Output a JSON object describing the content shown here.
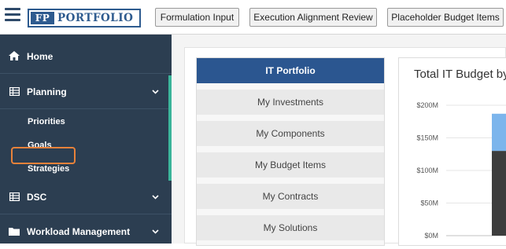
{
  "app": {
    "logo_fp": "FP",
    "logo_text": "PORTFOLIO"
  },
  "top_tabs": [
    {
      "label": "Formulation Input"
    },
    {
      "label": "Execution Alignment Review"
    },
    {
      "label": "Placeholder Budget Items"
    }
  ],
  "sidebar": {
    "home": {
      "label": "Home",
      "icon": "home-icon"
    },
    "planning": {
      "label": "Planning",
      "icon": "grid-table-icon",
      "expanded": true,
      "children": [
        {
          "label": "Priorities",
          "highlighted": true
        },
        {
          "label": "Goals"
        },
        {
          "label": "Strategies"
        }
      ]
    },
    "dsc": {
      "label": "DSC",
      "icon": "grid-table-icon"
    },
    "workload": {
      "label": "Workload Management",
      "icon": "folder-icon"
    }
  },
  "portfolio_menu": [
    {
      "label": "IT Portfolio",
      "active": true
    },
    {
      "label": "My Investments"
    },
    {
      "label": "My Components"
    },
    {
      "label": "My Budget Items"
    },
    {
      "label": "My Contracts"
    },
    {
      "label": "My Solutions"
    }
  ],
  "chart_data": {
    "type": "bar",
    "title": "Total IT Budget by",
    "y_ticks": [
      "$200M",
      "$150M",
      "$100M",
      "$50M",
      "$0M"
    ],
    "ylim": [
      0,
      200
    ],
    "grid": true,
    "series": [
      {
        "values": [
          130
        ],
        "color": "#3d3d3d"
      },
      {
        "values": [
          57
        ],
        "color": "#7cb5ec"
      }
    ],
    "categories": [
      ""
    ]
  }
}
